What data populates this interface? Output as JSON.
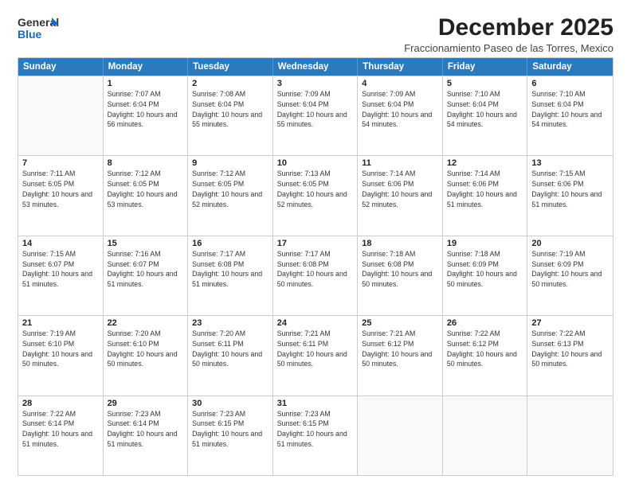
{
  "logo": {
    "general": "General",
    "blue": "Blue"
  },
  "header": {
    "month": "December 2025",
    "location": "Fraccionamiento Paseo de las Torres, Mexico"
  },
  "days_of_week": [
    "Sunday",
    "Monday",
    "Tuesday",
    "Wednesday",
    "Thursday",
    "Friday",
    "Saturday"
  ],
  "weeks": [
    [
      {
        "day": "",
        "empty": true
      },
      {
        "day": "1",
        "sunrise": "Sunrise: 7:07 AM",
        "sunset": "Sunset: 6:04 PM",
        "daylight": "Daylight: 10 hours and 56 minutes."
      },
      {
        "day": "2",
        "sunrise": "Sunrise: 7:08 AM",
        "sunset": "Sunset: 6:04 PM",
        "daylight": "Daylight: 10 hours and 55 minutes."
      },
      {
        "day": "3",
        "sunrise": "Sunrise: 7:09 AM",
        "sunset": "Sunset: 6:04 PM",
        "daylight": "Daylight: 10 hours and 55 minutes."
      },
      {
        "day": "4",
        "sunrise": "Sunrise: 7:09 AM",
        "sunset": "Sunset: 6:04 PM",
        "daylight": "Daylight: 10 hours and 54 minutes."
      },
      {
        "day": "5",
        "sunrise": "Sunrise: 7:10 AM",
        "sunset": "Sunset: 6:04 PM",
        "daylight": "Daylight: 10 hours and 54 minutes."
      },
      {
        "day": "6",
        "sunrise": "Sunrise: 7:10 AM",
        "sunset": "Sunset: 6:04 PM",
        "daylight": "Daylight: 10 hours and 54 minutes."
      }
    ],
    [
      {
        "day": "7",
        "sunrise": "Sunrise: 7:11 AM",
        "sunset": "Sunset: 6:05 PM",
        "daylight": "Daylight: 10 hours and 53 minutes."
      },
      {
        "day": "8",
        "sunrise": "Sunrise: 7:12 AM",
        "sunset": "Sunset: 6:05 PM",
        "daylight": "Daylight: 10 hours and 53 minutes."
      },
      {
        "day": "9",
        "sunrise": "Sunrise: 7:12 AM",
        "sunset": "Sunset: 6:05 PM",
        "daylight": "Daylight: 10 hours and 52 minutes."
      },
      {
        "day": "10",
        "sunrise": "Sunrise: 7:13 AM",
        "sunset": "Sunset: 6:05 PM",
        "daylight": "Daylight: 10 hours and 52 minutes."
      },
      {
        "day": "11",
        "sunrise": "Sunrise: 7:14 AM",
        "sunset": "Sunset: 6:06 PM",
        "daylight": "Daylight: 10 hours and 52 minutes."
      },
      {
        "day": "12",
        "sunrise": "Sunrise: 7:14 AM",
        "sunset": "Sunset: 6:06 PM",
        "daylight": "Daylight: 10 hours and 51 minutes."
      },
      {
        "day": "13",
        "sunrise": "Sunrise: 7:15 AM",
        "sunset": "Sunset: 6:06 PM",
        "daylight": "Daylight: 10 hours and 51 minutes."
      }
    ],
    [
      {
        "day": "14",
        "sunrise": "Sunrise: 7:15 AM",
        "sunset": "Sunset: 6:07 PM",
        "daylight": "Daylight: 10 hours and 51 minutes."
      },
      {
        "day": "15",
        "sunrise": "Sunrise: 7:16 AM",
        "sunset": "Sunset: 6:07 PM",
        "daylight": "Daylight: 10 hours and 51 minutes."
      },
      {
        "day": "16",
        "sunrise": "Sunrise: 7:17 AM",
        "sunset": "Sunset: 6:08 PM",
        "daylight": "Daylight: 10 hours and 51 minutes."
      },
      {
        "day": "17",
        "sunrise": "Sunrise: 7:17 AM",
        "sunset": "Sunset: 6:08 PM",
        "daylight": "Daylight: 10 hours and 50 minutes."
      },
      {
        "day": "18",
        "sunrise": "Sunrise: 7:18 AM",
        "sunset": "Sunset: 6:08 PM",
        "daylight": "Daylight: 10 hours and 50 minutes."
      },
      {
        "day": "19",
        "sunrise": "Sunrise: 7:18 AM",
        "sunset": "Sunset: 6:09 PM",
        "daylight": "Daylight: 10 hours and 50 minutes."
      },
      {
        "day": "20",
        "sunrise": "Sunrise: 7:19 AM",
        "sunset": "Sunset: 6:09 PM",
        "daylight": "Daylight: 10 hours and 50 minutes."
      }
    ],
    [
      {
        "day": "21",
        "sunrise": "Sunrise: 7:19 AM",
        "sunset": "Sunset: 6:10 PM",
        "daylight": "Daylight: 10 hours and 50 minutes."
      },
      {
        "day": "22",
        "sunrise": "Sunrise: 7:20 AM",
        "sunset": "Sunset: 6:10 PM",
        "daylight": "Daylight: 10 hours and 50 minutes."
      },
      {
        "day": "23",
        "sunrise": "Sunrise: 7:20 AM",
        "sunset": "Sunset: 6:11 PM",
        "daylight": "Daylight: 10 hours and 50 minutes."
      },
      {
        "day": "24",
        "sunrise": "Sunrise: 7:21 AM",
        "sunset": "Sunset: 6:11 PM",
        "daylight": "Daylight: 10 hours and 50 minutes."
      },
      {
        "day": "25",
        "sunrise": "Sunrise: 7:21 AM",
        "sunset": "Sunset: 6:12 PM",
        "daylight": "Daylight: 10 hours and 50 minutes."
      },
      {
        "day": "26",
        "sunrise": "Sunrise: 7:22 AM",
        "sunset": "Sunset: 6:12 PM",
        "daylight": "Daylight: 10 hours and 50 minutes."
      },
      {
        "day": "27",
        "sunrise": "Sunrise: 7:22 AM",
        "sunset": "Sunset: 6:13 PM",
        "daylight": "Daylight: 10 hours and 50 minutes."
      }
    ],
    [
      {
        "day": "28",
        "sunrise": "Sunrise: 7:22 AM",
        "sunset": "Sunset: 6:14 PM",
        "daylight": "Daylight: 10 hours and 51 minutes."
      },
      {
        "day": "29",
        "sunrise": "Sunrise: 7:23 AM",
        "sunset": "Sunset: 6:14 PM",
        "daylight": "Daylight: 10 hours and 51 minutes."
      },
      {
        "day": "30",
        "sunrise": "Sunrise: 7:23 AM",
        "sunset": "Sunset: 6:15 PM",
        "daylight": "Daylight: 10 hours and 51 minutes."
      },
      {
        "day": "31",
        "sunrise": "Sunrise: 7:23 AM",
        "sunset": "Sunset: 6:15 PM",
        "daylight": "Daylight: 10 hours and 51 minutes."
      },
      {
        "day": "",
        "empty": true
      },
      {
        "day": "",
        "empty": true
      },
      {
        "day": "",
        "empty": true
      }
    ]
  ]
}
